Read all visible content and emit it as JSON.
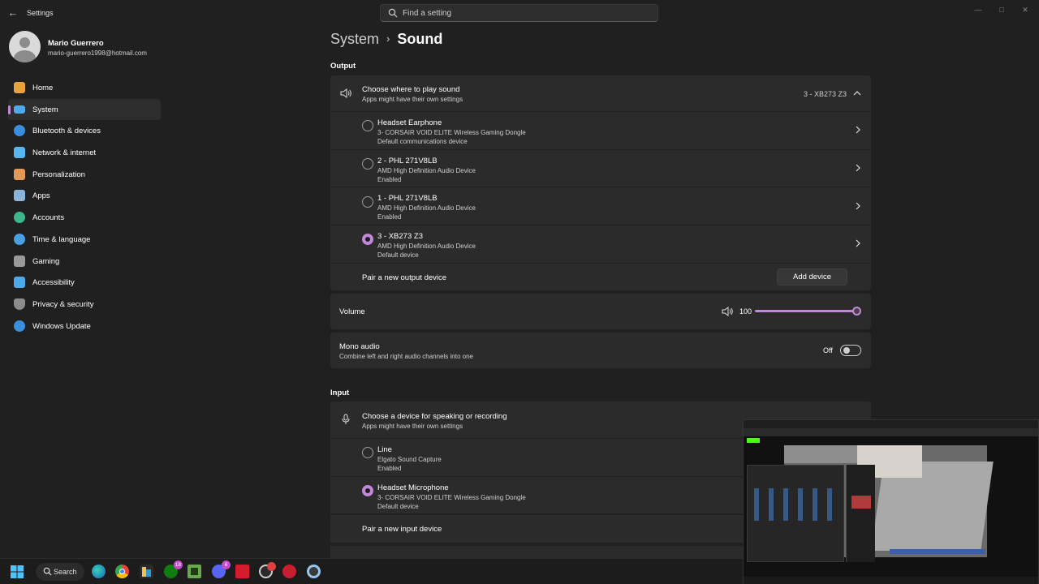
{
  "window": {
    "title": "Settings",
    "search_placeholder": "Find a setting"
  },
  "profile": {
    "name": "Mario Guerrero",
    "email": "mario-guerrero1998@hotmail.com"
  },
  "nav": [
    {
      "label": "Home",
      "icon": "home-icon",
      "active": false,
      "color": "#e8a23b"
    },
    {
      "label": "System",
      "icon": "system-icon",
      "active": true,
      "color": "#4fa8e8"
    },
    {
      "label": "Bluetooth & devices",
      "icon": "bluetooth-icon",
      "active": false,
      "color": "#3a8fdc"
    },
    {
      "label": "Network & internet",
      "icon": "network-icon",
      "active": false,
      "color": "#5ab4f0"
    },
    {
      "label": "Personalization",
      "icon": "brush-icon",
      "active": false,
      "color": "#e09a5a"
    },
    {
      "label": "Apps",
      "icon": "apps-icon",
      "active": false,
      "color": "#8ab4d8"
    },
    {
      "label": "Accounts",
      "icon": "accounts-icon",
      "active": false,
      "color": "#3fb68b"
    },
    {
      "label": "Time & language",
      "icon": "globe-icon",
      "active": false,
      "color": "#4aa0e0"
    },
    {
      "label": "Gaming",
      "icon": "gamepad-icon",
      "active": false,
      "color": "#9a9a9a"
    },
    {
      "label": "Accessibility",
      "icon": "accessibility-icon",
      "active": false,
      "color": "#4fa8e8"
    },
    {
      "label": "Privacy & security",
      "icon": "shield-icon",
      "active": false,
      "color": "#8c8c8c"
    },
    {
      "label": "Windows Update",
      "icon": "update-icon",
      "active": false,
      "color": "#3a8fdc"
    }
  ],
  "breadcrumb": {
    "parent": "System",
    "separator": "›",
    "current": "Sound"
  },
  "output": {
    "heading": "Output",
    "chooser": {
      "title": "Choose where to play sound",
      "subtitle": "Apps might have their own settings",
      "selected": "3 - XB273 Z3"
    },
    "devices": [
      {
        "name": "Headset Earphone",
        "driver": "3- CORSAIR VOID ELITE Wireless Gaming Dongle",
        "status": "Default communications device",
        "selected": false
      },
      {
        "name": "2 - PHL 271V8LB",
        "driver": "AMD High Definition Audio Device",
        "status": "Enabled",
        "selected": false
      },
      {
        "name": "1 - PHL 271V8LB",
        "driver": "AMD High Definition Audio Device",
        "status": "Enabled",
        "selected": false
      },
      {
        "name": "3 - XB273 Z3",
        "driver": "AMD High Definition Audio Device",
        "status": "Default device",
        "selected": true
      }
    ],
    "pair_label": "Pair a new output device",
    "add_button": "Add device"
  },
  "volume": {
    "label": "Volume",
    "value": "100",
    "level": 1.0
  },
  "mono": {
    "title": "Mono audio",
    "subtitle": "Combine left and right audio channels into one",
    "state": "Off"
  },
  "input": {
    "heading": "Input",
    "chooser": {
      "title": "Choose a device for speaking or recording",
      "subtitle": "Apps might have their own settings"
    },
    "devices": [
      {
        "name": "Line",
        "driver": "Elgato Sound Capture",
        "status": "Enabled",
        "selected": false
      },
      {
        "name": "Headset Microphone",
        "driver": "3- CORSAIR VOID ELITE Wireless Gaming Dongle",
        "status": "Default device",
        "selected": true
      }
    ],
    "pair_label": "Pair a new input device"
  },
  "taskbar": {
    "search_label": "Search",
    "xbox_badge": "18",
    "discord_badge": "6"
  },
  "colors": {
    "accent": "#c387d9",
    "background": "#202020",
    "card": "#2b2b2b"
  }
}
